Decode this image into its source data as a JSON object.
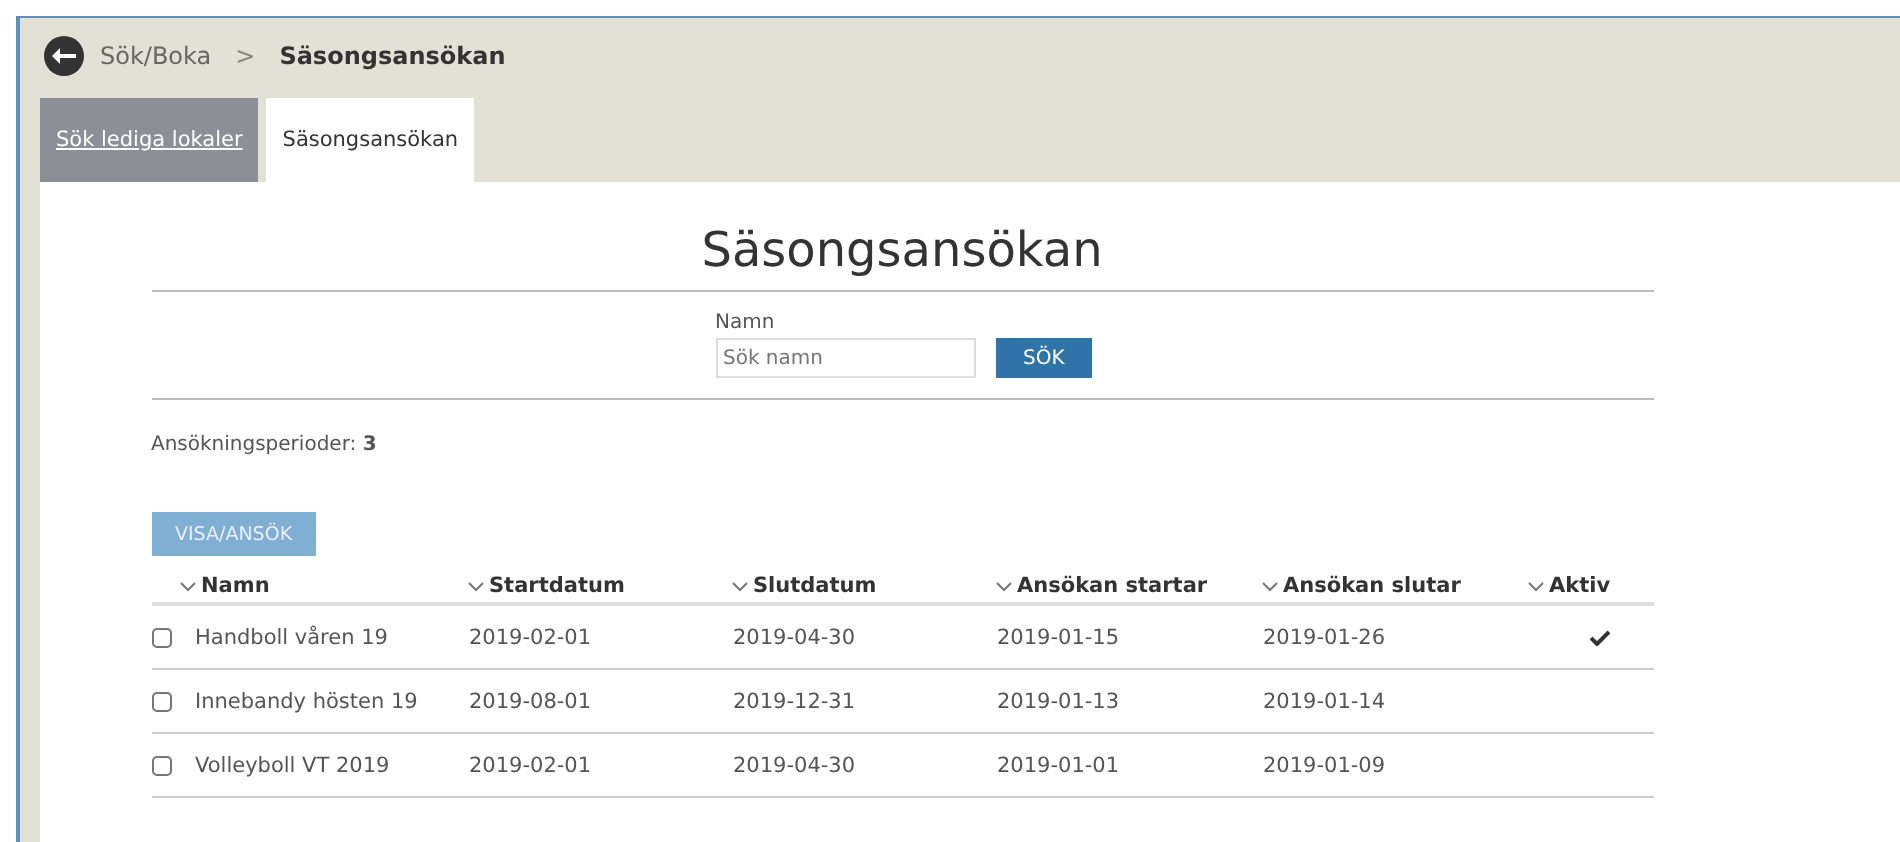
{
  "breadcrumb": {
    "parent": "Sök/Boka",
    "separator": ">",
    "current": "Säsongsansökan"
  },
  "tabs": [
    {
      "label": "Sök lediga lokaler",
      "selected": false
    },
    {
      "label": "Säsongsansökan",
      "selected": true
    }
  ],
  "heading": "Säsongsansökan",
  "search": {
    "label": "Namn",
    "placeholder": "Sök namn",
    "button": "SÖK"
  },
  "periods": {
    "label": "Ansökningsperioder:",
    "count": "3"
  },
  "action_button": "VISA/ANSÖK",
  "table": {
    "columns": [
      "Namn",
      "Startdatum",
      "Slutdatum",
      "Ansökan startar",
      "Ansökan slutar",
      "Aktiv"
    ],
    "rows": [
      {
        "checked": false,
        "cells": [
          "Handboll våren 19",
          "2019-02-01",
          "2019-04-30",
          "2019-01-15",
          "2019-01-26"
        ],
        "active": true
      },
      {
        "checked": false,
        "cells": [
          "Innebandy hösten 19",
          "2019-08-01",
          "2019-12-31",
          "2019-01-13",
          "2019-01-14"
        ],
        "active": false
      },
      {
        "checked": false,
        "cells": [
          "Volleyboll VT 2019",
          "2019-02-01",
          "2019-04-30",
          "2019-01-01",
          "2019-01-09"
        ],
        "active": false
      }
    ]
  }
}
